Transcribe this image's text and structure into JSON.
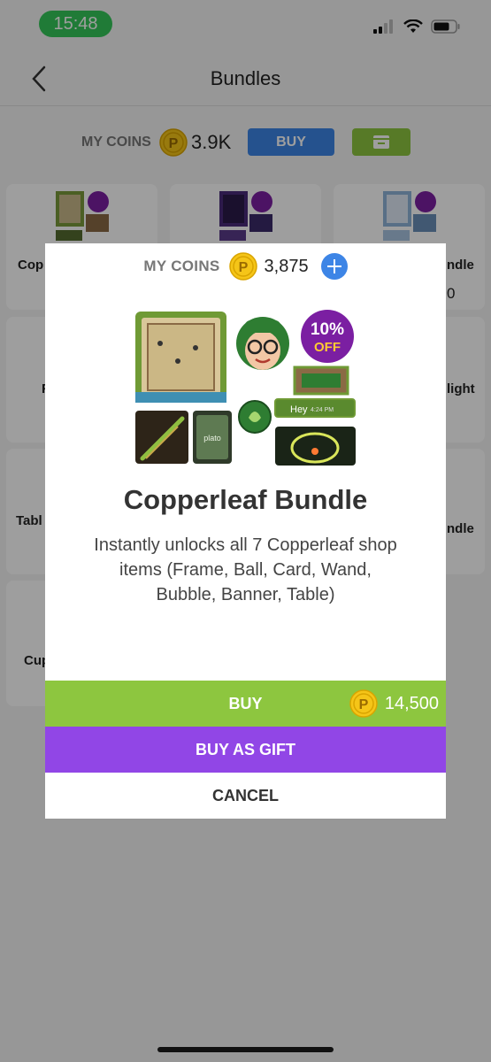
{
  "status_bar": {
    "time": "15:48"
  },
  "nav": {
    "title": "Bundles"
  },
  "coins_bar": {
    "label": "MY COINS",
    "value": "3.9K",
    "buy_label": "BUY"
  },
  "cards": [
    {
      "label_visible": "Cop"
    },
    {
      "label_visible": ""
    },
    {
      "label_visible": "ndle"
    },
    {
      "sub_visible": "0"
    },
    {
      "label_visible": "F"
    },
    {
      "label_visible": "light"
    },
    {
      "label_visible": "Tabl"
    },
    {
      "label_visible": "ndle"
    },
    {
      "label_visible": "Cup"
    }
  ],
  "modal": {
    "coins_label": "MY COINS",
    "coins_value": "3,875",
    "art": {
      "discount_pct": "10%",
      "discount_word": "OFF",
      "bubble_text": "Hey",
      "bubble_time": "4:24 PM",
      "card_text": "plato"
    },
    "title": "Copperleaf Bundle",
    "description": "Instantly unlocks all 7 Copperleaf shop items (Frame, Ball, Card, Wand, Bubble, Banner, Table)",
    "buy_label": "BUY",
    "price": "14,500",
    "gift_label": "BUY AS GIFT",
    "cancel_label": "CANCEL"
  },
  "colors": {
    "green": "#8dc63f",
    "purple": "#9146e6",
    "blue": "#3d85e6",
    "coin": "#f5c518"
  }
}
